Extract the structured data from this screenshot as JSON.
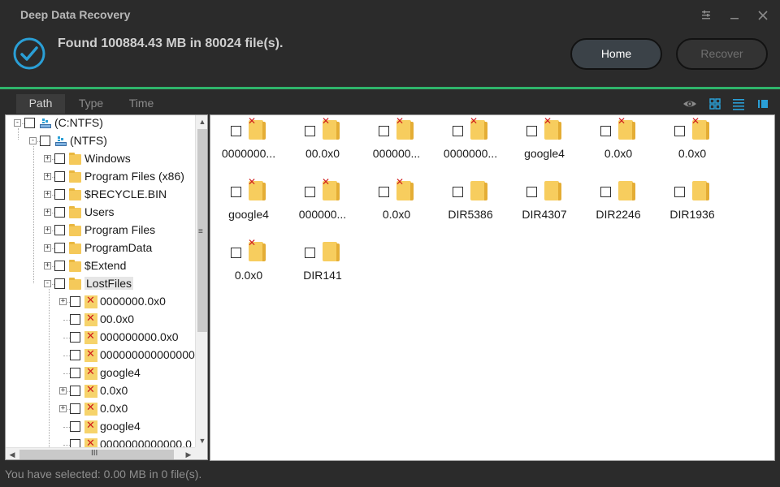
{
  "app": {
    "title": "Deep Data Recovery",
    "found_text": "Found 100884.43 MB in 80024 file(s).",
    "accent_color": "#2fb56b"
  },
  "buttons": {
    "home": "Home",
    "recover": "Recover"
  },
  "tabs": [
    "Path",
    "Type",
    "Time"
  ],
  "active_tab": "Path",
  "view_icons": [
    "eye-icon",
    "grid-view-icon",
    "list-view-icon",
    "detail-view-icon"
  ],
  "tree": [
    {
      "label": "(C:NTFS)",
      "level": 0,
      "expander": "-",
      "icon": "drive"
    },
    {
      "label": "(NTFS)",
      "level": 1,
      "expander": "-",
      "icon": "drive"
    },
    {
      "label": "Windows",
      "level": 2,
      "expander": "+",
      "icon": "folder"
    },
    {
      "label": "Program Files (x86)",
      "level": 2,
      "expander": "+",
      "icon": "folder"
    },
    {
      "label": "$RECYCLE.BIN",
      "level": 2,
      "expander": "+",
      "icon": "folder"
    },
    {
      "label": "Users",
      "level": 2,
      "expander": "+",
      "icon": "folder"
    },
    {
      "label": "Program Files",
      "level": 2,
      "expander": "+",
      "icon": "folder"
    },
    {
      "label": "ProgramData",
      "level": 2,
      "expander": "+",
      "icon": "folder"
    },
    {
      "label": "$Extend",
      "level": 2,
      "expander": "+",
      "icon": "folder"
    },
    {
      "label": "LostFiles",
      "level": 2,
      "expander": "-",
      "icon": "folder",
      "selected": true
    },
    {
      "label": "0000000.0x0",
      "level": 3,
      "expander": "+",
      "icon": "lost"
    },
    {
      "label": "00.0x0",
      "level": 3,
      "expander": "",
      "icon": "lost"
    },
    {
      "label": "000000000.0x0",
      "level": 3,
      "expander": "",
      "icon": "lost"
    },
    {
      "label": "000000000000000",
      "level": 3,
      "expander": "",
      "icon": "lost"
    },
    {
      "label": "google4",
      "level": 3,
      "expander": "",
      "icon": "lost"
    },
    {
      "label": "0.0x0",
      "level": 3,
      "expander": "+",
      "icon": "lost"
    },
    {
      "label": "0.0x0",
      "level": 3,
      "expander": "+",
      "icon": "lost"
    },
    {
      "label": "google4",
      "level": 3,
      "expander": "",
      "icon": "lost"
    },
    {
      "label": "0000000000000.0",
      "level": 3,
      "expander": "",
      "icon": "lost"
    }
  ],
  "grid": [
    {
      "label": "0000000...",
      "lost": true
    },
    {
      "label": "00.0x0",
      "lost": true
    },
    {
      "label": "000000...",
      "lost": true
    },
    {
      "label": "0000000...",
      "lost": true
    },
    {
      "label": "google4",
      "lost": true
    },
    {
      "label": "0.0x0",
      "lost": true
    },
    {
      "label": "0.0x0",
      "lost": true
    },
    {
      "label": "google4",
      "lost": true
    },
    {
      "label": "000000...",
      "lost": true
    },
    {
      "label": "0.0x0",
      "lost": true
    },
    {
      "label": "DIR5386",
      "lost": false
    },
    {
      "label": "DIR4307",
      "lost": false
    },
    {
      "label": "DIR2246",
      "lost": false
    },
    {
      "label": "DIR1936",
      "lost": false
    },
    {
      "label": "0.0x0",
      "lost": true
    },
    {
      "label": "DIR141",
      "lost": false
    }
  ],
  "status": "You have selected: 0.00 MB in 0 file(s)."
}
